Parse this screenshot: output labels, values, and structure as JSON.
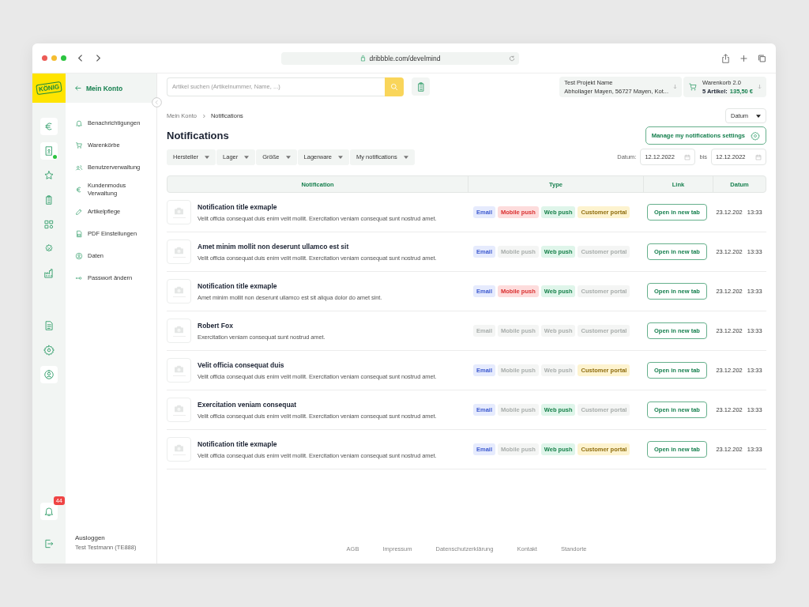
{
  "browser": {
    "url": "dribbble.com/develmind"
  },
  "logo": {
    "text": "KÖNIG"
  },
  "rail": {
    "main": [
      {
        "selected": true,
        "dot": false
      },
      {
        "selected": true,
        "dot": true
      },
      {
        "selected": false,
        "dot": false
      },
      {
        "selected": false,
        "dot": false
      },
      {
        "selected": false,
        "dot": false
      },
      {
        "selected": false,
        "dot": false
      },
      {
        "selected": false,
        "dot": false
      }
    ],
    "tools": [
      {
        "selected": false
      },
      {
        "selected": false
      },
      {
        "selected": true
      }
    ],
    "bottom": [
      {
        "selected": true,
        "badge": "44"
      },
      {
        "selected": false
      }
    ]
  },
  "sidebar": {
    "title": "Mein Konto",
    "items": [
      {
        "label": "Benachrichtigungen"
      },
      {
        "label": "Warenkörbe"
      },
      {
        "label": "Benutzerverwaltung"
      },
      {
        "label": "Kundenmodus Verwaltung"
      },
      {
        "label": "Artikelpflege"
      },
      {
        "label": "PDF Einstellungen"
      },
      {
        "label": "Daten"
      },
      {
        "label": "Passwort ändern"
      }
    ],
    "logout": "Ausloggen",
    "user": "Test Testmann (TE888)"
  },
  "topbar": {
    "search_placeholder": "Artikel suchen (Artikelnummer, Name, ...)",
    "project": {
      "name": "Test Projekt Name",
      "address": "Abhollager Mayen, 56727 Mayen, Kot..."
    },
    "cart": {
      "name": "Warenkorb 2.0",
      "count": "5 Artikel:",
      "total": "135,50 €"
    }
  },
  "breadcrumb": [
    "Mein Konto",
    "Notifications"
  ],
  "sort": "Datum",
  "title": "Notifications",
  "manage_button": "Manage my notifications settings",
  "filters": [
    "Hersteller",
    "Lager",
    "Größe",
    "Lagerware",
    "My notifications"
  ],
  "date_range": {
    "label": "Datum:",
    "from": "12.12.2022",
    "separator": "bis",
    "to": "12.12.2022"
  },
  "table": {
    "columns": [
      "Notification",
      "Type",
      "Link",
      "Datum"
    ],
    "rows": [
      {
        "title": "Notification title exmaple",
        "text": "Velit officia consequat duis enim velit mollit. Exercitation veniam consequat sunt nostrud amet.",
        "types": [
          {
            "kind": "email",
            "label": "Email",
            "on": true
          },
          {
            "kind": "mobile",
            "label": "Mobile push",
            "on": true
          },
          {
            "kind": "web",
            "label": "Web push",
            "on": true
          },
          {
            "kind": "portal",
            "label": "Customer portal",
            "on": true
          }
        ],
        "link": "Open in new tab",
        "date": "23.12.202",
        "time": "13:33"
      },
      {
        "title": "Amet minim mollit non deserunt ullamco est sit",
        "text": "Velit officia consequat duis enim velit mollit. Exercitation veniam consequat sunt nostrud amet.",
        "types": [
          {
            "kind": "email",
            "label": "Email",
            "on": true
          },
          {
            "kind": "mobile",
            "label": "Mobile push",
            "on": false
          },
          {
            "kind": "web",
            "label": "Web push",
            "on": true
          },
          {
            "kind": "portal",
            "label": "Customer portal",
            "on": false
          }
        ],
        "link": "Open in new tab",
        "date": "23.12.202",
        "time": "13:33"
      },
      {
        "title": "Notification title exmaple",
        "text": "Amet minim mollit non deserunt ullamco est sit aliqua dolor do amet sint.",
        "types": [
          {
            "kind": "email",
            "label": "Email",
            "on": true
          },
          {
            "kind": "mobile",
            "label": "Mobile push",
            "on": true
          },
          {
            "kind": "web",
            "label": "Web push",
            "on": true
          },
          {
            "kind": "portal",
            "label": "Customer portal",
            "on": false
          }
        ],
        "link": "Open in new tab",
        "date": "23.12.202",
        "time": "13:33"
      },
      {
        "title": "Robert Fox",
        "text": "Exercitation veniam consequat sunt nostrud amet.",
        "types": [
          {
            "kind": "email",
            "label": "Email",
            "on": false
          },
          {
            "kind": "mobile",
            "label": "Mobile push",
            "on": false
          },
          {
            "kind": "web",
            "label": "Web push",
            "on": false
          },
          {
            "kind": "portal",
            "label": "Customer portal",
            "on": false
          }
        ],
        "link": "Open in new tab",
        "date": "23.12.202",
        "time": "13:33"
      },
      {
        "title": "Velit officia consequat duis",
        "text": "Velit officia consequat duis enim velit mollit. Exercitation veniam consequat sunt nostrud amet.",
        "types": [
          {
            "kind": "email",
            "label": "Email",
            "on": true
          },
          {
            "kind": "mobile",
            "label": "Mobile push",
            "on": false
          },
          {
            "kind": "web",
            "label": "Web push",
            "on": false
          },
          {
            "kind": "portal",
            "label": "Customer portal",
            "on": true
          }
        ],
        "link": "Open in new tab",
        "date": "23.12.202",
        "time": "13:33"
      },
      {
        "title": "Exercitation veniam consequat",
        "text": "Velit officia consequat duis enim velit mollit. Exercitation veniam consequat sunt nostrud amet.",
        "types": [
          {
            "kind": "email",
            "label": "Email",
            "on": true
          },
          {
            "kind": "mobile",
            "label": "Mobile push",
            "on": false
          },
          {
            "kind": "web",
            "label": "Web push",
            "on": true
          },
          {
            "kind": "portal",
            "label": "Customer portal",
            "on": false
          }
        ],
        "link": "Open in new tab",
        "date": "23.12.202",
        "time": "13:33"
      },
      {
        "title": "Notification title exmaple",
        "text": "Velit officia consequat duis enim velit mollit. Exercitation veniam consequat sunt nostrud amet.",
        "types": [
          {
            "kind": "email",
            "label": "Email",
            "on": true
          },
          {
            "kind": "mobile",
            "label": "Mobile push",
            "on": false
          },
          {
            "kind": "web",
            "label": "Web push",
            "on": true
          },
          {
            "kind": "portal",
            "label": "Customer portal",
            "on": true
          }
        ],
        "link": "Open in new tab",
        "date": "23.12.202",
        "time": "13:33"
      }
    ]
  },
  "footer": [
    "AGB",
    "Impressum",
    "Datenschutzerklärung",
    "Kontakt",
    "Standorte"
  ]
}
